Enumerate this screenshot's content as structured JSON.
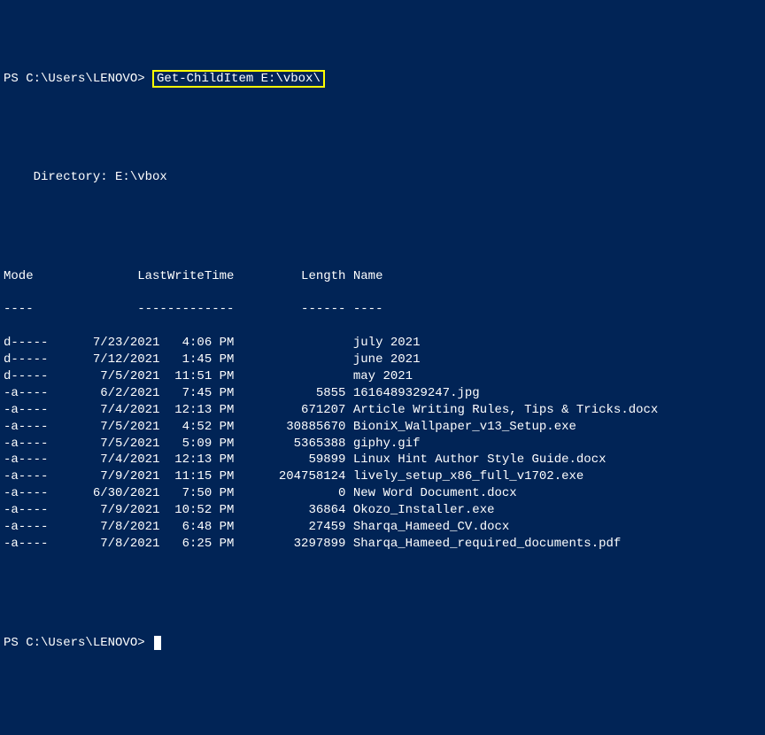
{
  "prompt1": {
    "prefix": "PS C:\\Users\\LENOVO> ",
    "command": "Get-ChildItem E:\\vbox\\"
  },
  "directory_label": "    Directory: E:\\vbox",
  "headers": {
    "mode": "Mode",
    "lastwrite": "LastWriteTime",
    "length": "Length",
    "name": "Name"
  },
  "rows": [
    {
      "mode": "d-----",
      "date": "7/23/2021",
      "time": "4:06 PM",
      "length": "",
      "name": "july 2021"
    },
    {
      "mode": "d-----",
      "date": "7/12/2021",
      "time": "1:45 PM",
      "length": "",
      "name": "june 2021"
    },
    {
      "mode": "d-----",
      "date": "7/5/2021",
      "time": "11:51 PM",
      "length": "",
      "name": "may 2021"
    },
    {
      "mode": "-a----",
      "date": "6/2/2021",
      "time": "7:45 PM",
      "length": "5855",
      "name": "1616489329247.jpg"
    },
    {
      "mode": "-a----",
      "date": "7/4/2021",
      "time": "12:13 PM",
      "length": "671207",
      "name": "Article Writing Rules, Tips & Tricks.docx"
    },
    {
      "mode": "-a----",
      "date": "7/5/2021",
      "time": "4:52 PM",
      "length": "30885670",
      "name": "BioniX_Wallpaper_v13_Setup.exe"
    },
    {
      "mode": "-a----",
      "date": "7/5/2021",
      "time": "5:09 PM",
      "length": "5365388",
      "name": "giphy.gif"
    },
    {
      "mode": "-a----",
      "date": "7/4/2021",
      "time": "12:13 PM",
      "length": "59899",
      "name": "Linux Hint Author Style Guide.docx"
    },
    {
      "mode": "-a----",
      "date": "7/9/2021",
      "time": "11:15 PM",
      "length": "204758124",
      "name": "lively_setup_x86_full_v1702.exe"
    },
    {
      "mode": "-a----",
      "date": "6/30/2021",
      "time": "7:50 PM",
      "length": "0",
      "name": "New Word Document.docx"
    },
    {
      "mode": "-a----",
      "date": "7/9/2021",
      "time": "10:52 PM",
      "length": "36864",
      "name": "Okozo_Installer.exe"
    },
    {
      "mode": "-a----",
      "date": "7/8/2021",
      "time": "6:48 PM",
      "length": "27459",
      "name": "Sharqa_Hameed_CV.docx"
    },
    {
      "mode": "-a----",
      "date": "7/8/2021",
      "time": "6:25 PM",
      "length": "3297899",
      "name": "Sharqa_Hameed_required_documents.pdf"
    }
  ],
  "prompt2": "PS C:\\Users\\LENOVO> "
}
